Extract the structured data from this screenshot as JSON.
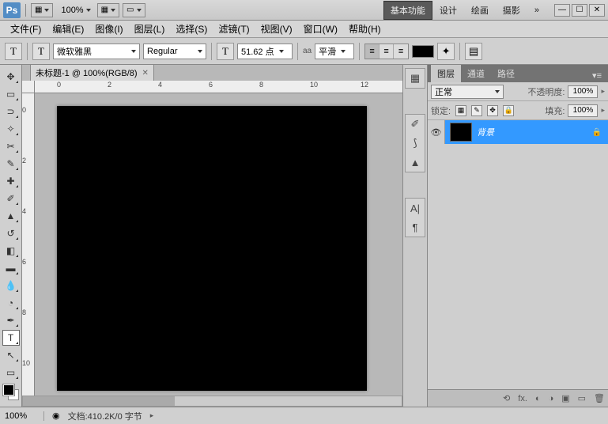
{
  "titlebar": {
    "logo": "Ps",
    "zoom": "100%",
    "workspaces": [
      "基本功能",
      "设计",
      "绘画",
      "摄影"
    ],
    "active_ws": 0,
    "more": "»"
  },
  "menu": [
    "文件(F)",
    "编辑(E)",
    "图像(I)",
    "图层(L)",
    "选择(S)",
    "滤镜(T)",
    "视图(V)",
    "窗口(W)",
    "帮助(H)"
  ],
  "options": {
    "tool_glyph": "T",
    "orientation_glyph": "T",
    "font_family": "微软雅黑",
    "font_style": "Regular",
    "font_size": "51.62 点",
    "aa_label": "aa",
    "aa_value": "平滑"
  },
  "doc_tab": "未标题-1 @ 100%(RGB/8)",
  "ruler_h": [
    "0",
    "2",
    "4",
    "6",
    "8",
    "10",
    "12"
  ],
  "ruler_v": [
    "0",
    "2",
    "4",
    "6",
    "8",
    "10"
  ],
  "panel": {
    "tabs": [
      "图层",
      "通道",
      "路径"
    ],
    "active": 0,
    "blend": "正常",
    "opacity_label": "不透明度:",
    "opacity": "100%",
    "lock_label": "锁定:",
    "fill_label": "填充:",
    "fill": "100%",
    "layer_name": "背景"
  },
  "status": {
    "zoom": "100%",
    "doc": "文档:410.2K/0 字节"
  },
  "footer_icons": [
    "⟲",
    "fx.",
    "◐",
    "◑",
    "▣",
    "▭",
    "🗑"
  ]
}
